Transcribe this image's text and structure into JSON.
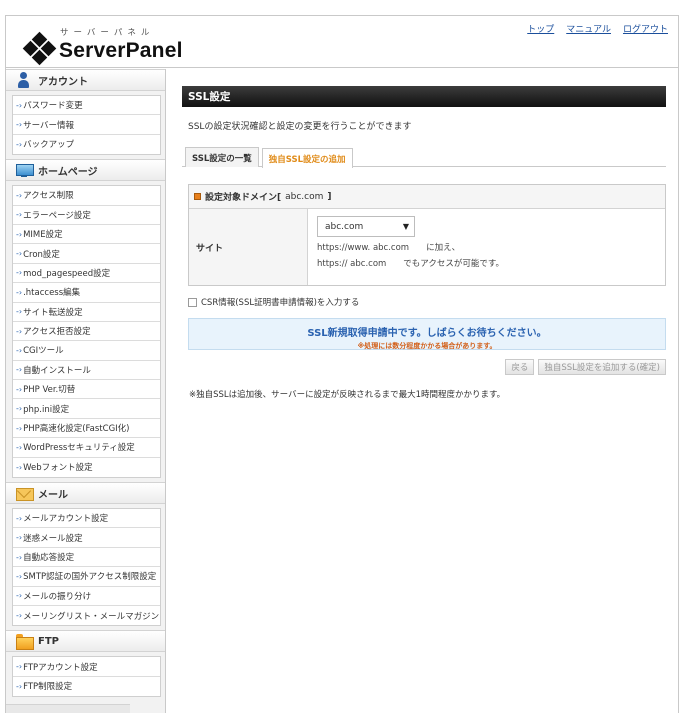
{
  "header": {
    "logo_kana": "サーバーパネル",
    "logo_name": "ServerPanel",
    "links": [
      "トップ",
      "マニュアル",
      "ログアウト"
    ]
  },
  "sidebar": {
    "account": {
      "title": "アカウント",
      "icon": "person-icon",
      "items": [
        "パスワード変更",
        "サーバー情報",
        "バックアップ"
      ]
    },
    "homepage": {
      "title": "ホームページ",
      "icon": "monitor-icon",
      "items": [
        "アクセス制限",
        "エラーページ設定",
        "MIME設定",
        "Cron設定",
        "mod_pagespeed設定",
        ".htaccess編集",
        "サイト転送設定",
        "アクセス拒否設定",
        "CGIツール",
        "自動インストール",
        "PHP Ver.切替",
        "php.ini設定",
        "PHP高速化設定(FastCGI化)",
        "WordPressセキュリティ設定",
        "Webフォント設定"
      ]
    },
    "mail": {
      "title": "メール",
      "icon": "mail-icon",
      "items": [
        "メールアカウント設定",
        "迷惑メール設定",
        "自動応答設定",
        "SMTP認証の国外アクセス制限設定",
        "メールの振り分け",
        "メーリングリスト・メールマガジン"
      ]
    },
    "ftp": {
      "title": "FTP",
      "icon": "folder-icon",
      "items": [
        "FTPアカウント設定",
        "FTP制限設定"
      ]
    }
  },
  "main": {
    "title": "SSL設定",
    "intro": "SSLの設定状況確認と設定の変更を行うことができます",
    "tabs": [
      "SSL設定の一覧",
      "独自SSL設定の追加"
    ],
    "domain_label": "設定対象ドメイン[",
    "domain_value": "abc.com",
    "domain_close": "]",
    "site_label": "サイト",
    "site_select": "abc.com",
    "url_line1": "https://www. abc.com　　に加え、",
    "url_line2": "https:// abc.com　　でもアクセスが可能です。",
    "csr_label": "CSR情報(SSL証明書申請情報)を入力する",
    "notice_main": "SSL新規取得申請中です。しばらくお待ちください。",
    "notice_sub": "※処理には数分程度かかる場合があります。",
    "btn_back": "戻る",
    "btn_confirm": "独自SSL設定を追加する(確定)",
    "footer_note": "※独自SSLは追加後、サーバーに設定が反映されるまで最大1時間程度かかります。"
  },
  "colors": {
    "accent_orange": "#e08b18",
    "link_blue": "#1b4f9c",
    "notice_blue": "#2a62b0"
  }
}
